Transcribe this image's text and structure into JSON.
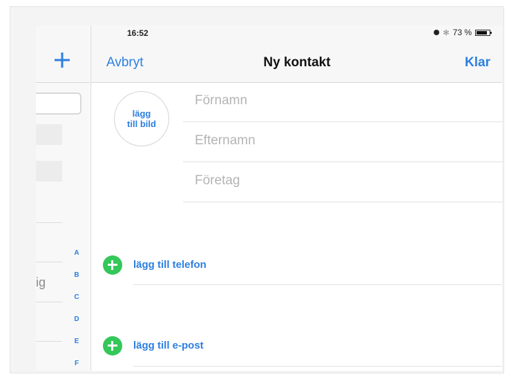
{
  "status_bar": {
    "time": "16:52",
    "battery": "73 %",
    "battery_level": 0.73,
    "icons": [
      "orientation-lock-icon",
      "bluetooth-icon",
      "battery-icon"
    ]
  },
  "left_panel": {
    "partial_text": "ig",
    "index_letters": [
      "A",
      "B",
      "C",
      "D",
      "E",
      "F"
    ]
  },
  "nav": {
    "add_icon": "plus-icon",
    "cancel_label": "Avbryt",
    "title": "Ny kontakt",
    "done_label": "Klar"
  },
  "photo": {
    "line1": "lägg",
    "line2": "till bild"
  },
  "fields": {
    "first_name": {
      "placeholder": "Förnamn",
      "value": ""
    },
    "last_name": {
      "placeholder": "Efternamn",
      "value": ""
    },
    "company": {
      "placeholder": "Företag",
      "value": ""
    }
  },
  "actions": {
    "add_phone": "lägg till telefon",
    "add_email": "lägg till e-post"
  },
  "colors": {
    "accent": "#2b7fe0",
    "add_green": "#34c759"
  }
}
